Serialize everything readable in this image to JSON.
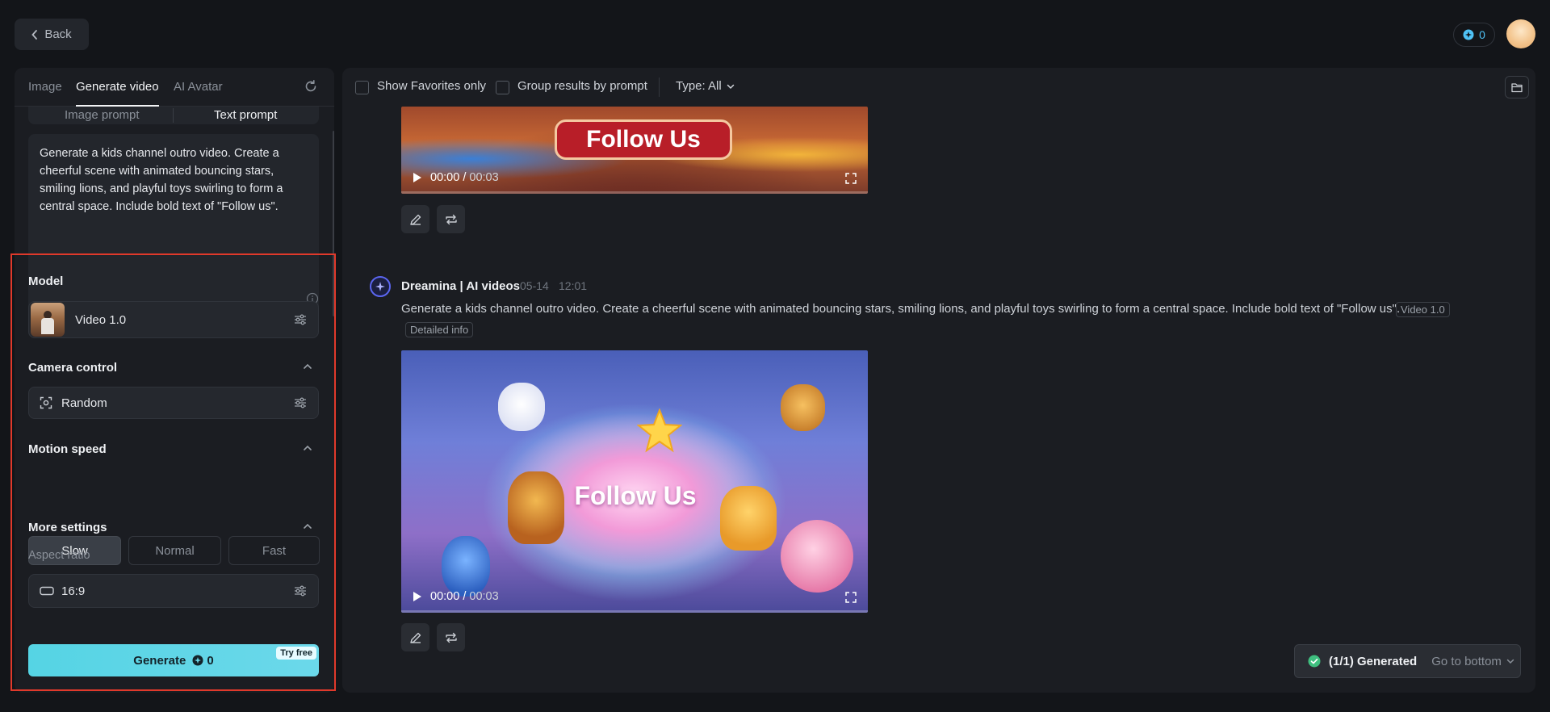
{
  "header": {
    "back_label": "Back",
    "credits": "0"
  },
  "left": {
    "tabs": [
      {
        "label": "Image",
        "active": false
      },
      {
        "label": "Generate video",
        "active": true
      },
      {
        "label": "AI Avatar",
        "active": false
      }
    ],
    "prompt_modes": [
      "Image prompt",
      "Text prompt"
    ],
    "active_prompt_mode": "Text prompt",
    "prompt_text": "Generate a kids channel outro video. Create a cheerful scene with animated bouncing stars, smiling lions, and playful toys swirling to form a central space. Include bold text of \"Follow us\".",
    "model": {
      "label": "Model",
      "value": "Video 1.0"
    },
    "camera": {
      "label": "Camera control",
      "value": "Random"
    },
    "motion": {
      "label": "Motion speed",
      "options": [
        "Slow",
        "Normal",
        "Fast"
      ],
      "selected": "Slow"
    },
    "more": {
      "label": "More settings",
      "aspect_label": "Aspect ratio",
      "aspect_value": "16:9"
    },
    "generate": {
      "label": "Generate",
      "cost": "0",
      "badge": "Try free"
    }
  },
  "right": {
    "toolbar": {
      "show_favorites": "Show Favorites only",
      "group_results": "Group results by prompt",
      "type_filter": "Type: All"
    },
    "videos": [
      {
        "current_time": "00:00",
        "total_time": "00:03",
        "overlay_text": "Follow Us"
      },
      {
        "current_time": "00:00",
        "total_time": "00:03",
        "overlay_text": "Follow Us"
      }
    ],
    "result": {
      "author": "Dreamina | AI videos",
      "date": "05-14",
      "time": "12:01",
      "prompt": "Generate a kids channel outro video. Create a cheerful scene with animated bouncing stars, smiling lions, and playful toys swirling to form a central space. Include bold text of \"Follow us\".",
      "model_tag": "Video 1.0",
      "details_tag": "Detailed info"
    },
    "toast": {
      "status": "(1/1) Generated",
      "link": "Go to bottom"
    }
  },
  "colors": {
    "accent": "#55d4e4",
    "highlight": "#e0392b",
    "background": "#131519",
    "panel": "#1b1d22"
  }
}
